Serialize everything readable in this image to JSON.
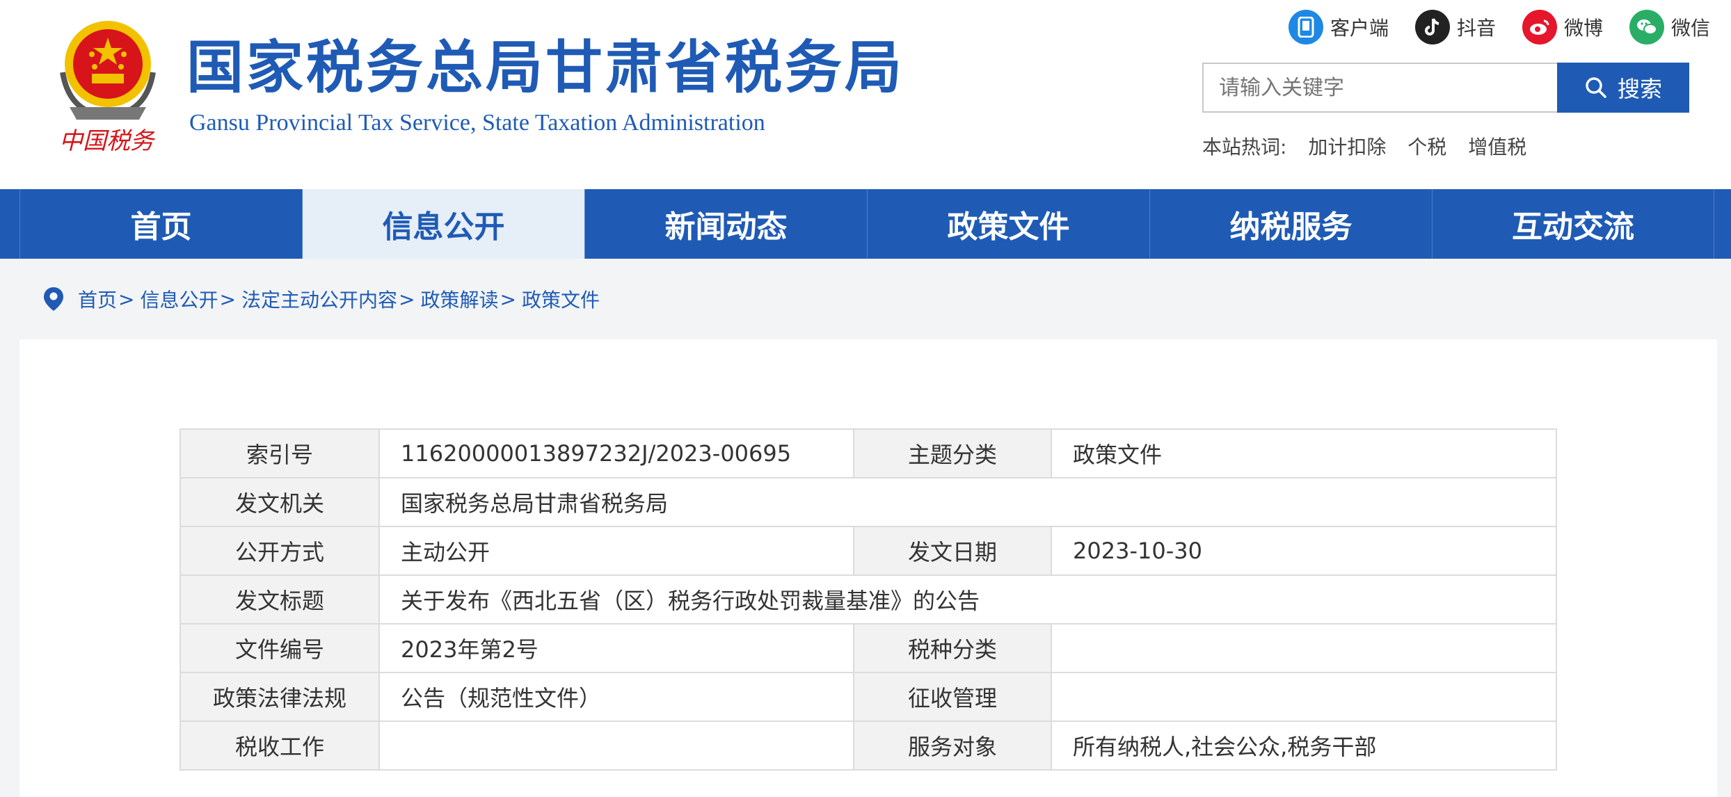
{
  "header": {
    "title_cn": "国家税务总局甘肃省税务局",
    "title_en": "Gansu Provincial Tax Service, State Taxation Administration",
    "logo_caption": "中国税务",
    "social": [
      {
        "label": "客户端",
        "icon": "mobile-app-icon",
        "color": "#1e88e5"
      },
      {
        "label": "抖音",
        "icon": "douyin-icon",
        "color": "#222222"
      },
      {
        "label": "微博",
        "icon": "weibo-icon",
        "color": "#e6162d"
      },
      {
        "label": "微信",
        "icon": "wechat-icon",
        "color": "#2aae67"
      }
    ],
    "search": {
      "placeholder": "请输入关键字",
      "button_label": "搜索"
    },
    "hot": {
      "label": "本站热词:",
      "words": [
        "加计扣除",
        "个税",
        "增值税"
      ]
    }
  },
  "nav": {
    "items": [
      {
        "label": "首页",
        "active": false
      },
      {
        "label": "信息公开",
        "active": true
      },
      {
        "label": "新闻动态",
        "active": false
      },
      {
        "label": "政策文件",
        "active": false
      },
      {
        "label": "纳税服务",
        "active": false
      },
      {
        "label": "互动交流",
        "active": false
      }
    ]
  },
  "breadcrumb": [
    "首页",
    "信息公开",
    "法定主动公开内容",
    "政策解读",
    "政策文件"
  ],
  "meta_table": {
    "index_label": "索引号",
    "index_value": "11620000013897232J/2023-00695",
    "topic_label": "主题分类",
    "topic_value": "政策文件",
    "issuer_label": "发文机关",
    "issuer_value": "国家税务总局甘肃省税务局",
    "disclosure_label": "公开方式",
    "disclosure_value": "主动公开",
    "date_label": "发文日期",
    "date_value": "2023-10-30",
    "title_label": "发文标题",
    "title_value": "关于发布《西北五省（区）税务行政处罚裁量基准》的公告",
    "docno_label": "文件编号",
    "docno_value": "2023年第2号",
    "taxtype_label": "税种分类",
    "taxtype_value": "",
    "law_label": "政策法律法规",
    "law_value": "公告（规范性文件）",
    "collection_label": "征收管理",
    "collection_value": "",
    "taxwork_label": "税收工作",
    "taxwork_value": "",
    "audience_label": "服务对象",
    "audience_value": "所有纳税人,社会公众,税务干部"
  },
  "colors": {
    "brand_blue": "#1f5bb5",
    "nav_active_bg": "#e6eef8",
    "page_bg": "#f3f4f6",
    "emblem_red": "#d7141a",
    "emblem_gold": "#f2c200"
  }
}
